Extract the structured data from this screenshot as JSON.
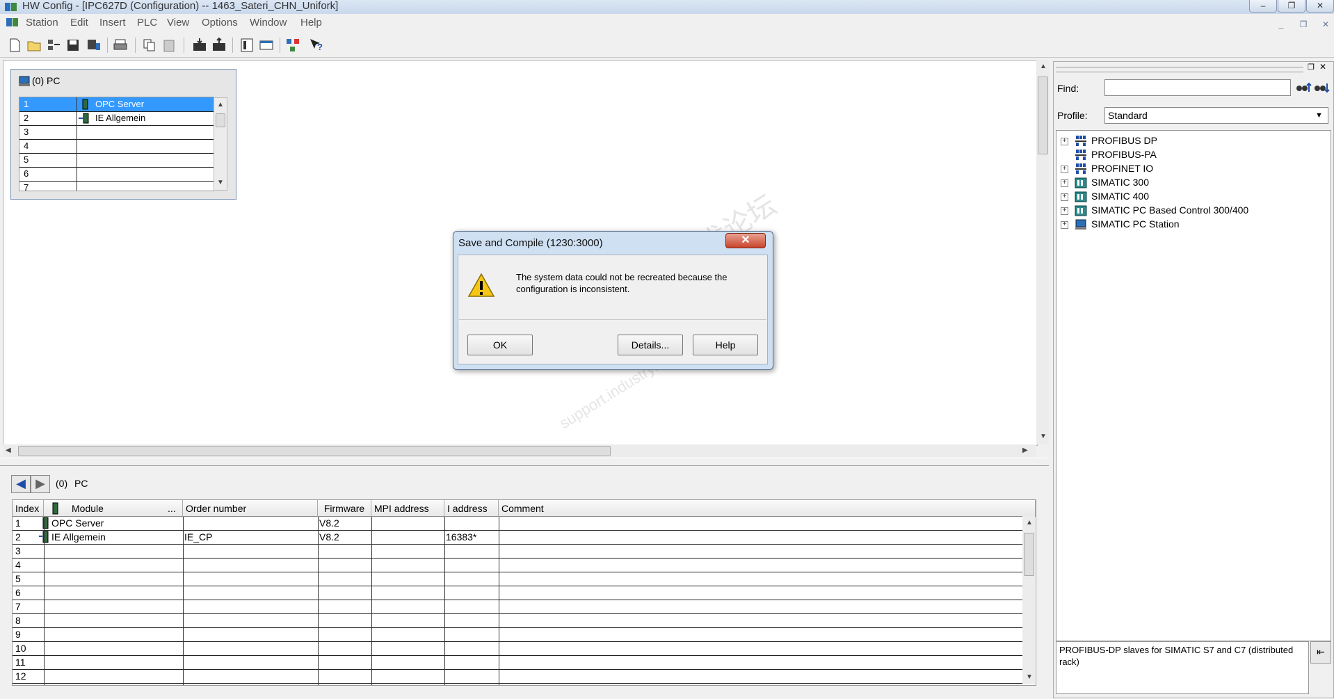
{
  "window": {
    "title": "HW Config - [IPC627D (Configuration) -- 1463_Sateri_CHN_Unifork]",
    "minimize": "–",
    "restore": "❐",
    "close": "✕"
  },
  "menu": [
    "Station",
    "Edit",
    "Insert",
    "PLC",
    "View",
    "Options",
    "Window",
    "Help"
  ],
  "mdi": {
    "minimize": "_",
    "restore": "❐",
    "close": "✕"
  },
  "rack": {
    "title": "(0) PC",
    "rows": [
      {
        "num": "1",
        "module": "OPC Server"
      },
      {
        "num": "2",
        "module": "IE Allgemein"
      },
      {
        "num": "3",
        "module": ""
      },
      {
        "num": "4",
        "module": ""
      },
      {
        "num": "5",
        "module": ""
      },
      {
        "num": "6",
        "module": ""
      },
      {
        "num": "7",
        "module": ""
      }
    ]
  },
  "dialog": {
    "title": "Save and Compile (1230:3000)",
    "close": "✕",
    "message": "The system data could not be recreated because the configuration is inconsistent.",
    "ok": "OK",
    "details": "Details...",
    "help": "Help"
  },
  "watermark": {
    "cn": "西门子工业 技术论坛",
    "url": "support.industry.siemens.com/cs"
  },
  "detail": {
    "path_index": "(0)",
    "path_name": "PC",
    "headers": {
      "index": "Index",
      "module": "Module",
      "dots": "...",
      "order": "Order number",
      "firmware": "Firmware",
      "mpi": "MPI address",
      "iaddr": "I address",
      "comment": "Comment"
    },
    "rows": [
      {
        "index": "1",
        "module": "OPC Server",
        "order": "",
        "firmware": "V8.2",
        "mpi": "",
        "iaddr": "",
        "comment": ""
      },
      {
        "index": "2",
        "module": "IE Allgemein",
        "order": "IE_CP",
        "firmware": "V8.2",
        "mpi": "",
        "iaddr": "16383*",
        "comment": ""
      },
      {
        "index": "3",
        "module": "",
        "order": "",
        "firmware": "",
        "mpi": "",
        "iaddr": "",
        "comment": ""
      },
      {
        "index": "4",
        "module": "",
        "order": "",
        "firmware": "",
        "mpi": "",
        "iaddr": "",
        "comment": ""
      },
      {
        "index": "5",
        "module": "",
        "order": "",
        "firmware": "",
        "mpi": "",
        "iaddr": "",
        "comment": ""
      },
      {
        "index": "6",
        "module": "",
        "order": "",
        "firmware": "",
        "mpi": "",
        "iaddr": "",
        "comment": ""
      },
      {
        "index": "7",
        "module": "",
        "order": "",
        "firmware": "",
        "mpi": "",
        "iaddr": "",
        "comment": ""
      },
      {
        "index": "8",
        "module": "",
        "order": "",
        "firmware": "",
        "mpi": "",
        "iaddr": "",
        "comment": ""
      },
      {
        "index": "9",
        "module": "",
        "order": "",
        "firmware": "",
        "mpi": "",
        "iaddr": "",
        "comment": ""
      },
      {
        "index": "10",
        "module": "",
        "order": "",
        "firmware": "",
        "mpi": "",
        "iaddr": "",
        "comment": ""
      },
      {
        "index": "11",
        "module": "",
        "order": "",
        "firmware": "",
        "mpi": "",
        "iaddr": "",
        "comment": ""
      },
      {
        "index": "12",
        "module": "",
        "order": "",
        "firmware": "",
        "mpi": "",
        "iaddr": "",
        "comment": ""
      }
    ]
  },
  "catalog": {
    "find_label": "Find:",
    "find_value": "",
    "profile_label": "Profile:",
    "profile_value": "Standard",
    "tree": [
      {
        "label": "PROFIBUS DP",
        "expandable": true,
        "icon": "network-icon"
      },
      {
        "label": "PROFIBUS-PA",
        "expandable": false,
        "icon": "network-icon"
      },
      {
        "label": "PROFINET IO",
        "expandable": true,
        "icon": "network-icon"
      },
      {
        "label": "SIMATIC 300",
        "expandable": true,
        "icon": "plc-icon"
      },
      {
        "label": "SIMATIC 400",
        "expandable": true,
        "icon": "plc-icon"
      },
      {
        "label": "SIMATIC PC Based Control 300/400",
        "expandable": true,
        "icon": "plc-icon"
      },
      {
        "label": "SIMATIC PC Station",
        "expandable": true,
        "icon": "pc-icon"
      }
    ],
    "description": "PROFIBUS-DP slaves for SIMATIC S7 and C7 (distributed rack)"
  }
}
